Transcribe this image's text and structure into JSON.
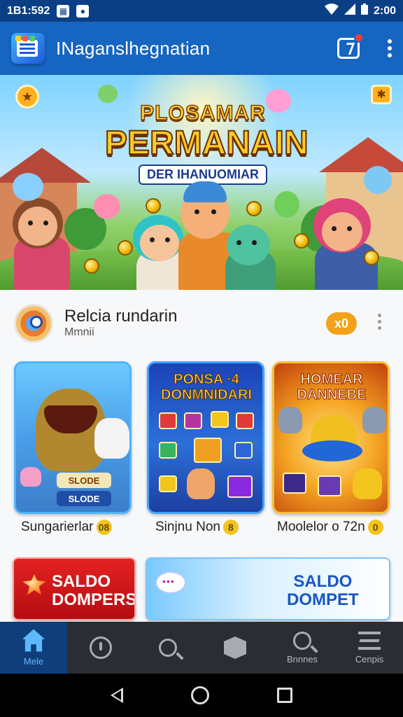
{
  "status_bar": {
    "left_text": "1B1:592",
    "time": "2:00",
    "icons": [
      "image-icon",
      "notification-icon",
      "wifi-icon",
      "signal-icon",
      "battery-icon"
    ]
  },
  "app_bar": {
    "title": "INaganslhegnatian",
    "notification_icon": "share-box-icon",
    "menu_icon": "more-vert-icon"
  },
  "hero": {
    "title_line1": "PLOSAMAR",
    "title_line2": "PERMANAIN",
    "subtitle": "DER IHANUOMIAR",
    "corner_left": "★",
    "corner_right": "✱"
  },
  "section": {
    "title": "Relcia rundarin",
    "subtitle": "Mmnii",
    "count_badge": "x0",
    "more_icon": "more-vert-icon"
  },
  "cards": [
    {
      "banner": "",
      "tag_top": "SLODE",
      "tag_bottom": "SLODE",
      "label": "Sungarierlar",
      "label_badge": "08"
    },
    {
      "banner": "PONSA ·4 DONMNIDARI",
      "tag_top": "",
      "tag_bottom": "",
      "label": "Sinjnu Non",
      "label_badge": "8"
    },
    {
      "banner": "HOMEAR DANNEBE",
      "tag_top": "",
      "tag_bottom": "",
      "label": "Moolelor o 72n",
      "label_badge": "0"
    }
  ],
  "promos": [
    {
      "line1": "SALDO",
      "line2": "DOMPERSY"
    },
    {
      "line1": "SALDO",
      "line2": "DOMPET"
    }
  ],
  "bottom_nav": [
    {
      "label": "Mele",
      "icon": "home-icon",
      "active": true
    },
    {
      "label": "",
      "icon": "info-circle-icon",
      "active": false
    },
    {
      "label": "",
      "icon": "search-icon",
      "active": false
    },
    {
      "label": "",
      "icon": "box-icon",
      "active": false
    },
    {
      "label": "Bnnnes",
      "icon": "search-icon",
      "active": false
    },
    {
      "label": "Cenpis",
      "icon": "stack-icon",
      "active": false
    }
  ],
  "colors": {
    "status_bar": "#0a3f86",
    "app_bar": "#1665c0",
    "accent": "#f2a21a",
    "nav_bg": "#2a2d33",
    "nav_active": "#5fb8ff"
  }
}
